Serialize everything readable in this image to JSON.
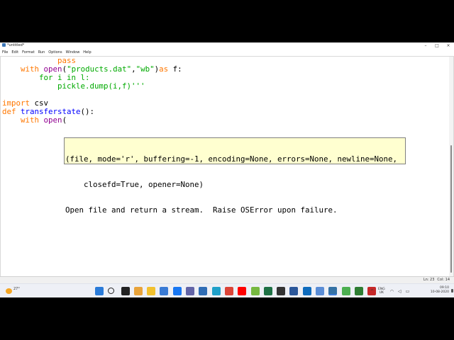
{
  "window": {
    "title": "*untitled*",
    "controls": {
      "minimize": "–",
      "maximize": "□",
      "close": "×"
    }
  },
  "menu": [
    "File",
    "Edit",
    "Format",
    "Run",
    "Options",
    "Window",
    "Help"
  ],
  "code_lines": [
    [
      {
        "t": "            ",
        "c": "tx"
      },
      {
        "t": "pass",
        "c": "kw"
      }
    ],
    [
      {
        "t": "    ",
        "c": "tx"
      },
      {
        "t": "with",
        "c": "kw"
      },
      {
        "t": " ",
        "c": "tx"
      },
      {
        "t": "open",
        "c": "bi"
      },
      {
        "t": "(",
        "c": "tx"
      },
      {
        "t": "\"products.dat\"",
        "c": "st"
      },
      {
        "t": ",",
        "c": "tx"
      },
      {
        "t": "\"wb\"",
        "c": "st"
      },
      {
        "t": ")",
        "c": "tx"
      },
      {
        "t": "as",
        "c": "kw"
      },
      {
        "t": " f:",
        "c": "tx"
      }
    ],
    [
      {
        "t": "        ",
        "c": "tx"
      },
      {
        "t": "for i in l:",
        "c": "st"
      }
    ],
    [
      {
        "t": "            ",
        "c": "tx"
      },
      {
        "t": "pickle.dump(i,f)'''",
        "c": "st"
      }
    ],
    [
      {
        "t": "",
        "c": "tx"
      }
    ],
    [
      {
        "t": "import",
        "c": "kw"
      },
      {
        "t": " csv",
        "c": "tx"
      }
    ],
    [
      {
        "t": "def",
        "c": "kw"
      },
      {
        "t": " ",
        "c": "tx"
      },
      {
        "t": "transferstate",
        "c": "df"
      },
      {
        "t": "():",
        "c": "tx"
      }
    ],
    [
      {
        "t": "    ",
        "c": "tx"
      },
      {
        "t": "with",
        "c": "kw"
      },
      {
        "t": " ",
        "c": "tx"
      },
      {
        "t": "open",
        "c": "bi"
      },
      {
        "t": "(",
        "c": "tx"
      }
    ]
  ],
  "calltip": {
    "signature_line1": "(file, mode='r', buffering=-1, encoding=None, errors=None, newline=None,",
    "signature_line2": "    closefd=True, opener=None)",
    "doc": "Open file and return a stream.  Raise OSError upon failure."
  },
  "status": {
    "line": "Ln: 23",
    "col": "Col: 14"
  },
  "taskbar": {
    "weather_temp": "27°",
    "apps": [
      {
        "name": "start-icon",
        "color": "#2a7bd8"
      },
      {
        "name": "search-icon",
        "color": "#222222"
      },
      {
        "name": "task-view-icon",
        "color": "#222222"
      },
      {
        "name": "widgets-icon",
        "color": "#e8a33a"
      },
      {
        "name": "file-explorer-icon",
        "color": "#f2c12e"
      },
      {
        "name": "store-icon",
        "color": "#3a7bd5"
      },
      {
        "name": "facebook-icon",
        "color": "#1877f2"
      },
      {
        "name": "teams-icon",
        "color": "#6264a7"
      },
      {
        "name": "media-player-icon",
        "color": "#2f6db5"
      },
      {
        "name": "edge-icon",
        "color": "#1fa0c9"
      },
      {
        "name": "chrome-icon",
        "color": "#db4437"
      },
      {
        "name": "youtube-icon",
        "color": "#ff0000"
      },
      {
        "name": "utorrent-icon",
        "color": "#76b83f"
      },
      {
        "name": "excel-icon",
        "color": "#1e7145"
      },
      {
        "name": "terminal-icon",
        "color": "#333333"
      },
      {
        "name": "word-icon",
        "color": "#2b579a"
      },
      {
        "name": "mail-icon",
        "color": "#0f6cbd"
      },
      {
        "name": "photos-icon",
        "color": "#5a8dd6"
      },
      {
        "name": "python-idle-icon",
        "color": "#3572a5"
      },
      {
        "name": "chrome-alt-icon",
        "color": "#4caf50"
      },
      {
        "name": "app-green-icon",
        "color": "#2e7d32"
      },
      {
        "name": "app-dark-icon",
        "color": "#c62828"
      }
    ],
    "tray_chevron": "^",
    "tray_lang_1": "ENG",
    "tray_lang_2": "UK",
    "tray_icons": [
      "wifi-icon",
      "speaker-icon",
      "battery-icon"
    ],
    "time": "09:10",
    "date": "10-08-2020"
  }
}
